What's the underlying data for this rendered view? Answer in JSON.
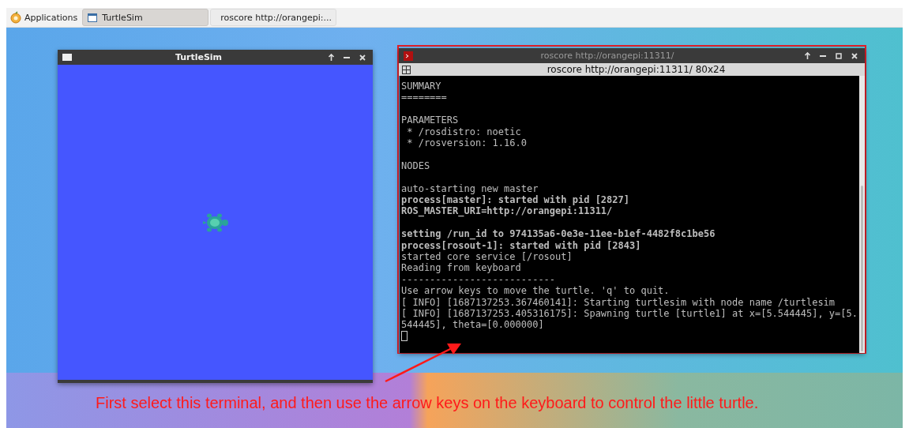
{
  "taskbar": {
    "menu": {
      "label": "Applications"
    },
    "tasks": [
      {
        "label": "TurtleSim",
        "kind": "window",
        "selected": true
      },
      {
        "label": "roscore http://orangepi:...",
        "kind": "terminal",
        "selected": false
      }
    ]
  },
  "turtlesim_window": {
    "title": "TurtleSim",
    "active": true
  },
  "terminal_window": {
    "title": "roscore http://orangepi:11311/",
    "active": false,
    "highlighted": true,
    "header": "roscore http://orangepi:11311/ 80x24",
    "blocks": [
      {
        "lines": [
          {
            "text": "SUMMARY",
            "bold": false
          },
          {
            "text": "========",
            "bold": false
          }
        ]
      },
      {
        "lines": [
          {
            "text": "PARAMETERS",
            "bold": false
          },
          {
            "text": " * /rosdistro: noetic",
            "bold": false
          },
          {
            "text": " * /rosversion: 1.16.0",
            "bold": false
          }
        ]
      },
      {
        "lines": [
          {
            "text": "NODES",
            "bold": false
          }
        ]
      },
      {
        "lines": [
          {
            "text": "auto-starting new master",
            "bold": false
          },
          {
            "text": "process[master]: started with pid [2827]",
            "bold": true
          },
          {
            "text": "ROS_MASTER_URI=http://orangepi:11311/",
            "bold": true
          }
        ]
      },
      {
        "lines": [
          {
            "text": "setting /run_id to 974135a6-0e3e-11ee-b1ef-4482f8c1be56",
            "bold": true
          },
          {
            "text": "process[rosout-1]: started with pid [2843]",
            "bold": true
          },
          {
            "text": "started core service [/rosout]",
            "bold": false
          },
          {
            "text": "Reading from keyboard",
            "bold": false
          },
          {
            "text": "---------------------------",
            "bold": false
          },
          {
            "text": "Use arrow keys to move the turtle. 'q' to quit.",
            "bold": false
          },
          {
            "text": "[ INFO] [1687137253.367460141]: Starting turtlesim with node name /turtlesim",
            "bold": false
          },
          {
            "text": "[ INFO] [1687137253.405316175]: Spawning turtle [turtle1] at x=[5.544445], y=[5.",
            "bold": false
          },
          {
            "text": "544445], theta=[0.000000]",
            "bold": false
          }
        ]
      }
    ]
  },
  "annotation": {
    "caption": "First select this terminal, and then use the arrow keys on the keyboard to control the little turtle."
  }
}
